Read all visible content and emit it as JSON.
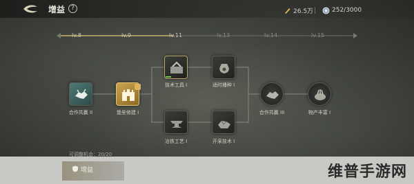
{
  "header": {
    "title": "增益",
    "help_symbol": "?",
    "resources": [
      {
        "icon": "pen-icon",
        "value": "26.5万"
      },
      {
        "icon": "token-icon",
        "value": "252/3000"
      }
    ]
  },
  "levels": [
    "lv.8",
    "lv.9",
    "lv.11",
    "lv.13",
    "lv.14",
    "lv.15"
  ],
  "nodes": {
    "n1": {
      "label": "合作共赢 II",
      "icon": "handshake-icon"
    },
    "n2": {
      "label": "堡垒修建 I",
      "icon": "castle-icon"
    },
    "n3": {
      "label": "技术工具 I",
      "icon": "toolbox-icon"
    },
    "n4": {
      "label": "冶铁工艺 I",
      "icon": "anvil-icon"
    },
    "n5": {
      "label": "适时播种 I",
      "icon": "seed-bag-icon"
    },
    "n6": {
      "label": "开采技术 I",
      "icon": "ore-icon"
    },
    "n7": {
      "label": "合作共赢 III",
      "icon": "handshake-icon"
    },
    "n8": {
      "label": "物产丰富 I",
      "icon": "harvest-icon"
    }
  },
  "chances": "可调整机会：20/20",
  "tab": {
    "label": "增益",
    "icon": "shield-icon"
  },
  "watermark": "维普手游网",
  "colors": {
    "accent": "#d9b45a",
    "progress": "#7ec24a",
    "teal": "#4f7a76"
  }
}
